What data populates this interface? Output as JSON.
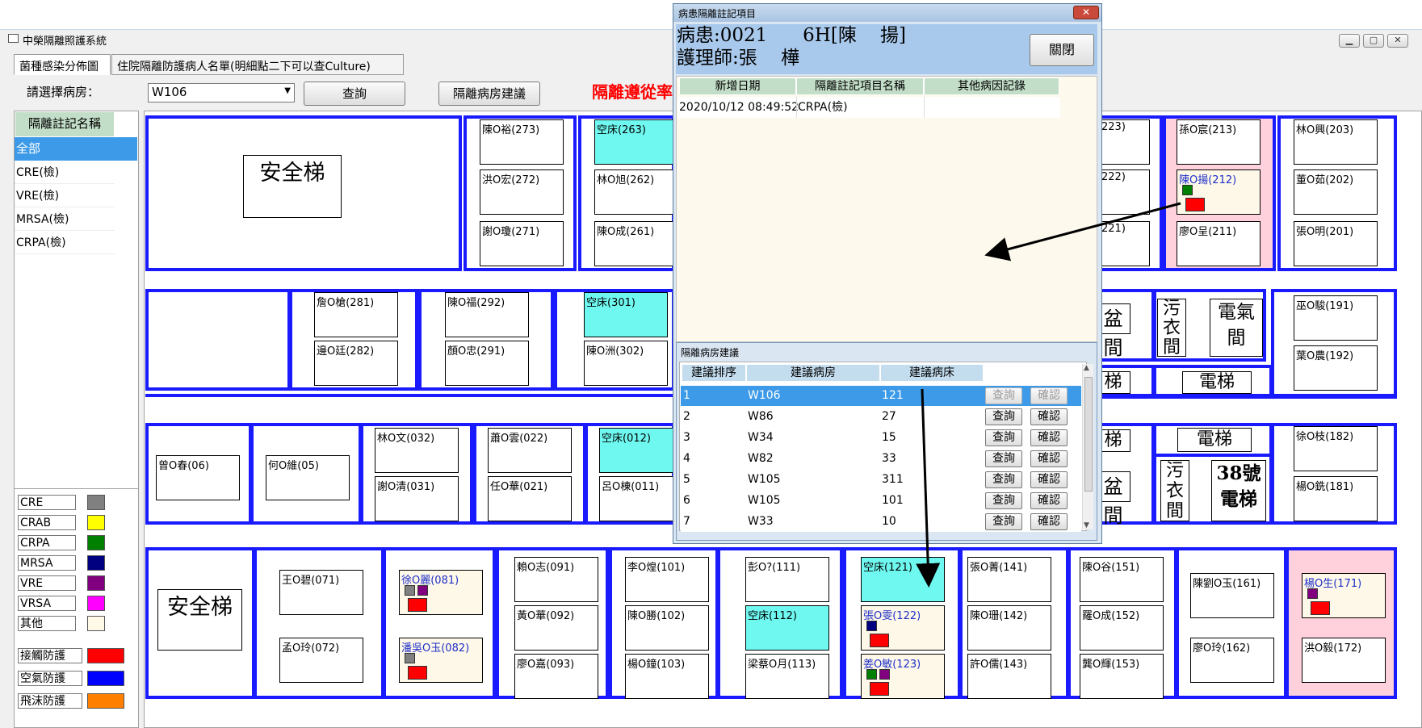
{
  "main": {
    "title": "中榮隔離照護系統",
    "tabs": [
      "菌種感染分佈圖",
      "住院隔離防護病人名單(明細點二下可以查Culture)"
    ],
    "ward_label": "請選擇病房：",
    "ward_value": "W106",
    "query_label": "查詢",
    "suggest_label": "隔離病房建議",
    "notice": "隔離遵從率"
  },
  "filter": {
    "header": "隔離註記名稱",
    "items": [
      "全部",
      "CRE(檢)",
      "VRE(檢)",
      "MRSA(檢)",
      "CRPA(檢)"
    ]
  },
  "legend": {
    "organisms": [
      {
        "name": "CRE",
        "color": "#808080"
      },
      {
        "name": "CRAB",
        "color": "#ffff00"
      },
      {
        "name": "CRPA",
        "color": "#008000"
      },
      {
        "name": "MRSA",
        "color": "#000080"
      },
      {
        "name": "VRE",
        "color": "#800080"
      },
      {
        "name": "VRSA",
        "color": "#ff00ff"
      },
      {
        "name": "其他",
        "color": "#fffae8"
      }
    ],
    "precautions": [
      {
        "name": "接觸防護",
        "color": "#ff0000"
      },
      {
        "name": "空氣防護",
        "color": "#0000ff"
      },
      {
        "name": "飛沫防護",
        "color": "#ff8000"
      }
    ]
  },
  "floor": {
    "stair_labels": [
      "安全梯",
      "安全梯"
    ],
    "utility_labels": [
      "盆間",
      "污衣間",
      "電氣間",
      "梯",
      "電梯",
      "梯",
      "電梯",
      "盆間",
      "污衣間",
      "38號電梯"
    ],
    "beds": [
      {
        "label": "陳O裕(273)"
      },
      {
        "label": "洪O宏(272)"
      },
      {
        "label": "謝O瓊(271)"
      },
      {
        "label": "空床(263)"
      },
      {
        "label": "林O旭(262)"
      },
      {
        "label": "陳O成(261)"
      },
      {
        "label": "223)"
      },
      {
        "label": "222)"
      },
      {
        "label": "221)"
      },
      {
        "label": "孫O宸(213)"
      },
      {
        "label": "陳O揚(212)"
      },
      {
        "label": "廖O呈(211)"
      },
      {
        "label": "林O興(203)"
      },
      {
        "label": "董O茹(202)"
      },
      {
        "label": "張O明(201)"
      },
      {
        "label": "詹O槍(281)"
      },
      {
        "label": "邊O廷(282)"
      },
      {
        "label": "陳O福(292)"
      },
      {
        "label": "顏O忠(291)"
      },
      {
        "label": "空床(301)"
      },
      {
        "label": "陳O洲(302)"
      },
      {
        "label": "巫O駿(191)"
      },
      {
        "label": "葉O農(192)"
      },
      {
        "label": "曾O春(06)"
      },
      {
        "label": "何O維(05)"
      },
      {
        "label": "林O文(032)"
      },
      {
        "label": "謝O清(031)"
      },
      {
        "label": "蕭O雲(022)"
      },
      {
        "label": "任O華(021)"
      },
      {
        "label": "空床(012)"
      },
      {
        "label": "呂O棟(011)"
      },
      {
        "label": "徐O枝(182)"
      },
      {
        "label": "楊O銑(181)"
      },
      {
        "label": "王O碧(071)"
      },
      {
        "label": "孟O玲(072)"
      },
      {
        "label": "徐O麗(081)"
      },
      {
        "label": "潘吳O玉(082)"
      },
      {
        "label": "賴O志(091)"
      },
      {
        "label": "黃O華(092)"
      },
      {
        "label": "廖O嘉(093)"
      },
      {
        "label": "李O煌(101)"
      },
      {
        "label": "陳O勝(102)"
      },
      {
        "label": "楊O鐘(103)"
      },
      {
        "label": "彭O?(111)"
      },
      {
        "label": "空床(112)"
      },
      {
        "label": "梁蔡O月(113)"
      },
      {
        "label": "空床(121)"
      },
      {
        "label": "張O雯(122)"
      },
      {
        "label": "姜O敏(123)"
      },
      {
        "label": "張O菁(141)"
      },
      {
        "label": "陳O珊(142)"
      },
      {
        "label": "許O儒(143)"
      },
      {
        "label": "陳O谷(151)"
      },
      {
        "label": "羅O成(152)"
      },
      {
        "label": "龔O輝(153)"
      },
      {
        "label": "陳劉O玉(161)"
      },
      {
        "label": "廖O玲(162)"
      },
      {
        "label": "楊O生(171)"
      },
      {
        "label": "洪O毅(172)"
      }
    ]
  },
  "note_dialog": {
    "title": "病患隔離註記項目",
    "patient_line": "病患:0021      6H[陳    揚]",
    "nurse_line": "護理師:張    樺",
    "close_label": "關閉",
    "columns": [
      "新增日期",
      "隔離註記項目名稱",
      "其他病因記錄"
    ],
    "rows": [
      [
        "2020/10/12 08:49:52",
        "CRPA(檢)",
        ""
      ]
    ]
  },
  "suggest_dialog": {
    "title": "隔離病房建議",
    "columns": [
      "建議排序",
      "建議病房",
      "建議病床"
    ],
    "query_label": "查詢",
    "confirm_label": "確認",
    "rows": [
      [
        "1",
        "W106",
        "121"
      ],
      [
        "2",
        "W86",
        "27"
      ],
      [
        "3",
        "W34",
        "15"
      ],
      [
        "4",
        "W82",
        "33"
      ],
      [
        "5",
        "W105",
        "311"
      ],
      [
        "6",
        "W105",
        "101"
      ],
      [
        "7",
        "W33",
        "10"
      ]
    ]
  }
}
